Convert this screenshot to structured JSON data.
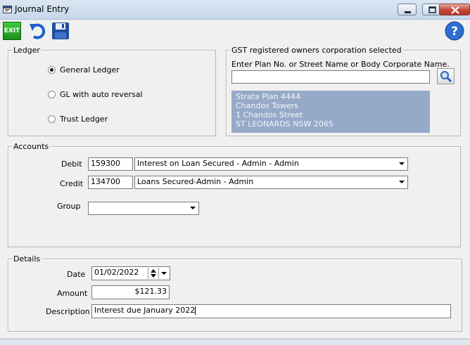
{
  "window": {
    "title": "Journal Entry"
  },
  "toolbar": {
    "exit_label": "EXIT"
  },
  "ledger": {
    "legend": "Ledger",
    "options": [
      {
        "label": "General Ledger",
        "selected": true
      },
      {
        "label": "GL with auto reversal",
        "selected": false
      },
      {
        "label": "Trust Ledger",
        "selected": false
      }
    ]
  },
  "gst": {
    "legend": "GST registered owners corporation selected",
    "search_label": "Enter Plan No. or Street Name or Body Corporate Name.",
    "search_value": "",
    "selected_lines": [
      "Strata Plan 4444",
      "Chandos Towers",
      "1 Chandos Street",
      "ST LEONARDS  NSW  2065"
    ]
  },
  "accounts": {
    "legend": "Accounts",
    "debit_label": "Debit",
    "debit_code": "159300",
    "debit_name": "Interest on Loan Secured - Admin - Admin",
    "credit_label": "Credit",
    "credit_code": "134700",
    "credit_name": "Loans Secured-Admin - Admin",
    "group_label": "Group",
    "group_value": ""
  },
  "details": {
    "legend": "Details",
    "date_label": "Date",
    "date_value": "01/02/2022",
    "amount_label": "Amount",
    "amount_value": "$121.33",
    "description_label": "Description",
    "description_value": "Interest due January 2022"
  },
  "colors": {
    "selected_box": "#95aac8",
    "exit_button": "#2aa52a",
    "help_button": "#2f6fd0"
  }
}
